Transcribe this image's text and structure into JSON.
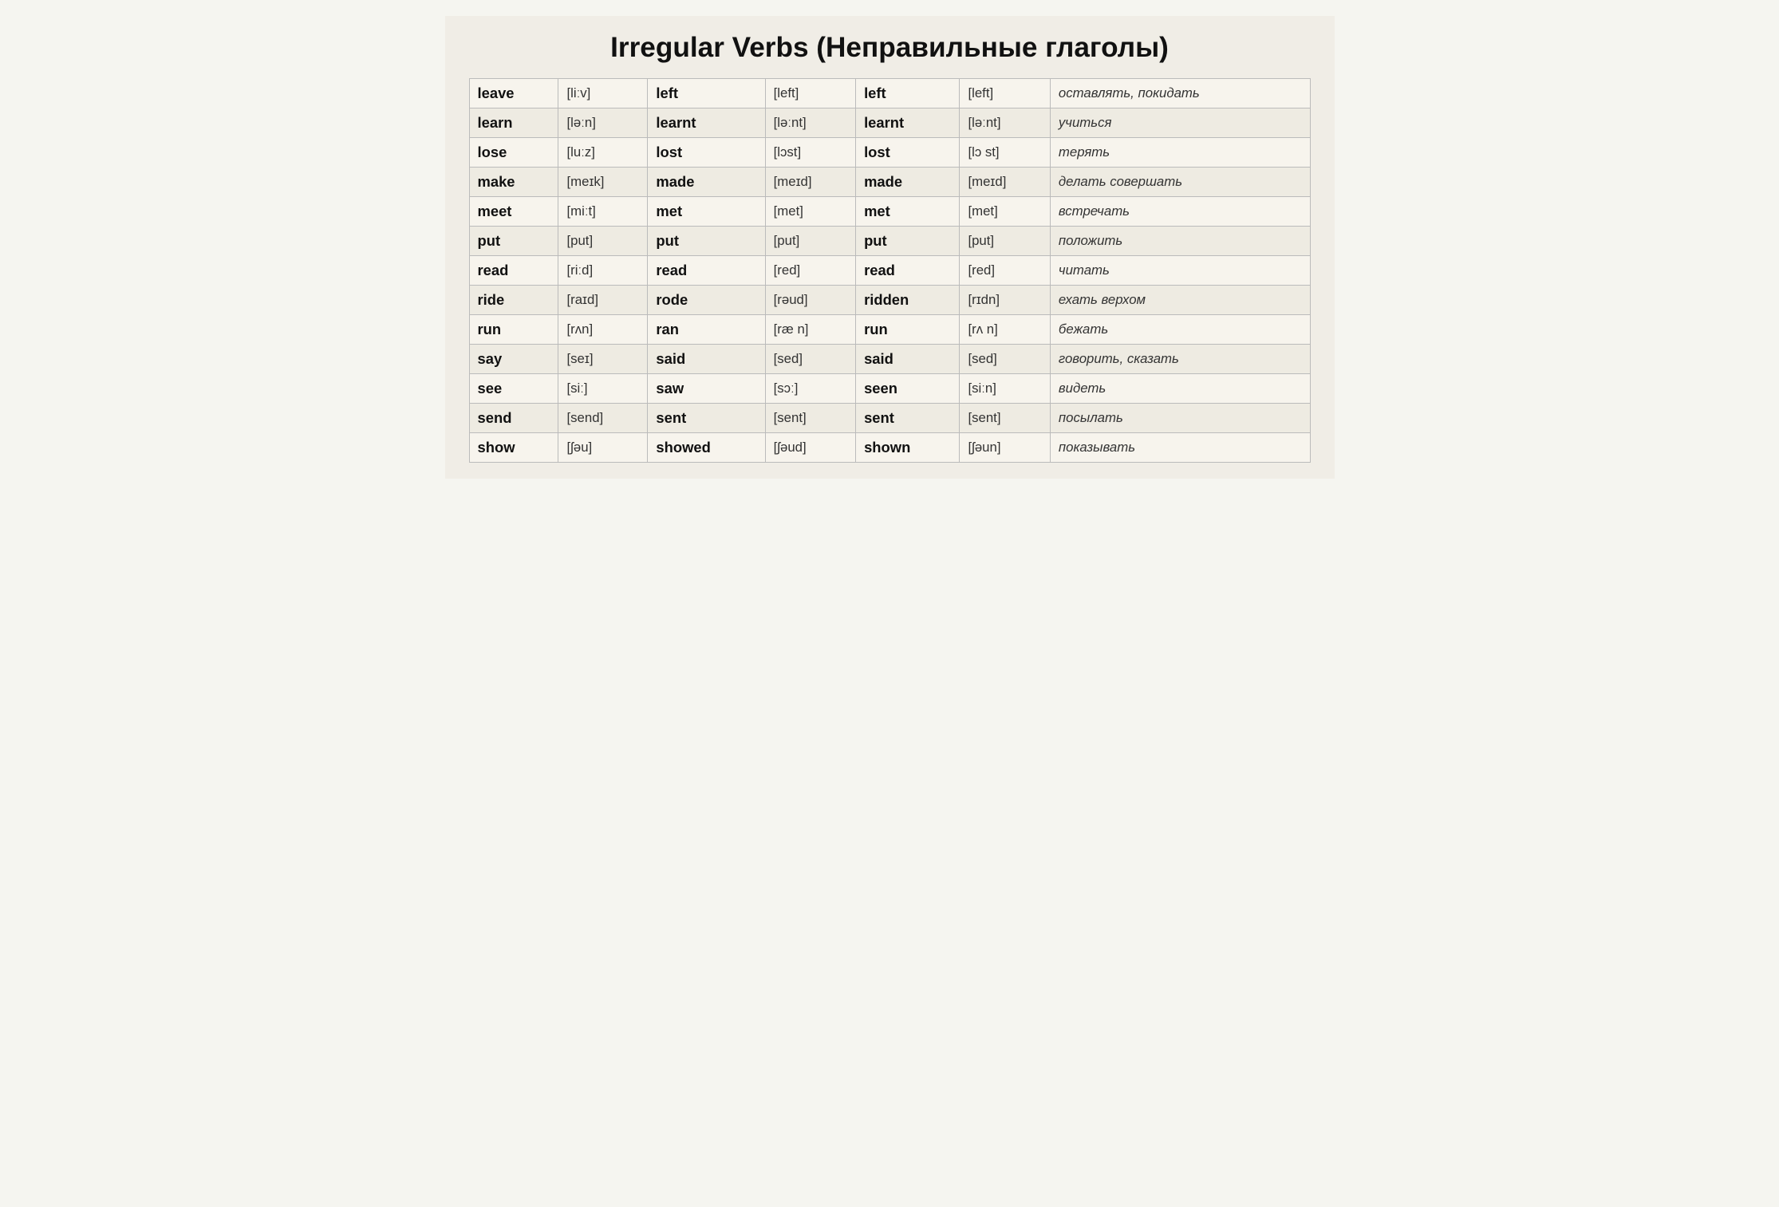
{
  "title": "Irregular Verbs (Неправильные глаголы)",
  "rows": [
    {
      "base": "leave",
      "base_ph": "[liːv]",
      "past": "left",
      "past_ph": "[left]",
      "pp": "left",
      "pp_ph": "[left]",
      "translation": "оставлять, покидать"
    },
    {
      "base": "learn",
      "base_ph": "[ləːn]",
      "past": "learnt",
      "past_ph": "[ləːnt]",
      "pp": "learnt",
      "pp_ph": "[ləːnt]",
      "translation": "учиться"
    },
    {
      "base": "lose",
      "base_ph": "[luːz]",
      "past": "lost",
      "past_ph": "[lɔst]",
      "pp": "lost",
      "pp_ph": "[lɔ st]",
      "translation": "терять"
    },
    {
      "base": "make",
      "base_ph": "[meɪk]",
      "past": "made",
      "past_ph": "[meɪd]",
      "pp": "made",
      "pp_ph": "[meɪd]",
      "translation": "делать совершать"
    },
    {
      "base": "meet",
      "base_ph": "[miːt]",
      "past": "met",
      "past_ph": "[met]",
      "pp": "met",
      "pp_ph": "[met]",
      "translation": "встречать"
    },
    {
      "base": "put",
      "base_ph": "[put]",
      "past": "put",
      "past_ph": "[put]",
      "pp": "put",
      "pp_ph": "[put]",
      "translation": "положить"
    },
    {
      "base": "read",
      "base_ph": "[riːd]",
      "past": "read",
      "past_ph": "[red]",
      "pp": "read",
      "pp_ph": "[red]",
      "translation": "читать"
    },
    {
      "base": "ride",
      "base_ph": "[raɪd]",
      "past": "rode",
      "past_ph": "[rəud]",
      "pp": "ridden",
      "pp_ph": "[rɪdn]",
      "translation": "ехать верхом"
    },
    {
      "base": "run",
      "base_ph": "[rʌn]",
      "past": "ran",
      "past_ph": "[ræ n]",
      "pp": "run",
      "pp_ph": "[rʌ n]",
      "translation": "бежать"
    },
    {
      "base": "say",
      "base_ph": "[seɪ]",
      "past": "said",
      "past_ph": "[sed]",
      "pp": "said",
      "pp_ph": "[sed]",
      "translation": "говорить, сказать"
    },
    {
      "base": "see",
      "base_ph": "[siː]",
      "past": "saw",
      "past_ph": "[sɔː]",
      "pp": "seen",
      "pp_ph": "[siːn]",
      "translation": "видеть"
    },
    {
      "base": "send",
      "base_ph": "[send]",
      "past": "sent",
      "past_ph": "[sent]",
      "pp": "sent",
      "pp_ph": "[sent]",
      "translation": "посылать"
    },
    {
      "base": "show",
      "base_ph": "[ʃəu]",
      "past": "showed",
      "past_ph": "[ʃəud]",
      "pp": "shown",
      "pp_ph": "[ʃəun]",
      "translation": "показывать"
    }
  ]
}
